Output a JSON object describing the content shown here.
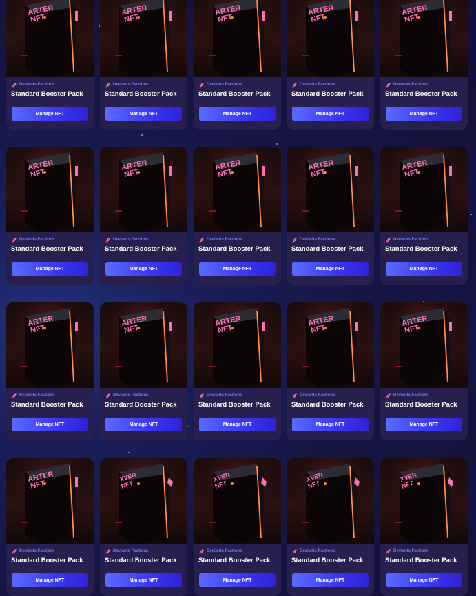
{
  "collection": {
    "name": "Deviants Factions",
    "icon": "feather-icon"
  },
  "colors": {
    "page_background": "#161543",
    "card_background": "#271f4e",
    "collection_text": "#6e7cff",
    "button_start": "#5a6bff",
    "button_end": "#2f22d6",
    "neon_sign": "#ff5fae",
    "neon_edge": "#ff7a2a"
  },
  "cards": [
    {
      "title": "Standard Booster Pack",
      "button_label": "Manage NFT",
      "collection": "Deviants Factions"
    },
    {
      "title": "Standard Booster Pack",
      "button_label": "Manage NFT",
      "collection": "Deviants Factions"
    },
    {
      "title": "Standard Booster Pack",
      "button_label": "Manage NFT",
      "collection": "Deviants Factions"
    },
    {
      "title": "Standard Booster Pack",
      "button_label": "Manage NFT",
      "collection": "Deviants Factions"
    },
    {
      "title": "Standard Booster Pack",
      "button_label": "Manage NFT",
      "collection": "Deviants Factions"
    },
    {
      "title": "Standard Booster Pack",
      "button_label": "Manage NFT",
      "collection": "Deviants Factions"
    },
    {
      "title": "Standard Booster Pack",
      "button_label": "Manage NFT",
      "collection": "Deviants Factions"
    },
    {
      "title": "Standard Booster Pack",
      "button_label": "Manage NFT",
      "collection": "Deviants Factions"
    },
    {
      "title": "Standard Booster Pack",
      "button_label": "Manage NFT",
      "collection": "Deviants Factions"
    },
    {
      "title": "Standard Booster Pack",
      "button_label": "Manage NFT",
      "collection": "Deviants Factions"
    },
    {
      "title": "Standard Booster Pack",
      "button_label": "Manage NFT",
      "collection": "Deviants Factions"
    },
    {
      "title": "Standard Booster Pack",
      "button_label": "Manage NFT",
      "collection": "Deviants Factions"
    },
    {
      "title": "Standard Booster Pack",
      "button_label": "Manage NFT",
      "collection": "Deviants Factions"
    },
    {
      "title": "Standard Booster Pack",
      "button_label": "Manage NFT",
      "collection": "Deviants Factions"
    },
    {
      "title": "Standard Booster Pack",
      "button_label": "Manage NFT",
      "collection": "Deviants Factions"
    },
    {
      "title": "Standard Booster Pack",
      "button_label": "Manage NFT",
      "collection": "Deviants Factions"
    },
    {
      "title": "Standard Booster Pack",
      "button_label": "Manage NFT",
      "collection": "Deviants Factions"
    },
    {
      "title": "Standard Booster Pack",
      "button_label": "Manage NFT",
      "collection": "Deviants Factions"
    },
    {
      "title": "Standard Booster Pack",
      "button_label": "Manage NFT",
      "collection": "Deviants Factions"
    },
    {
      "title": "Standard Booster Pack",
      "button_label": "Manage NFT",
      "collection": "Deviants Factions"
    }
  ]
}
